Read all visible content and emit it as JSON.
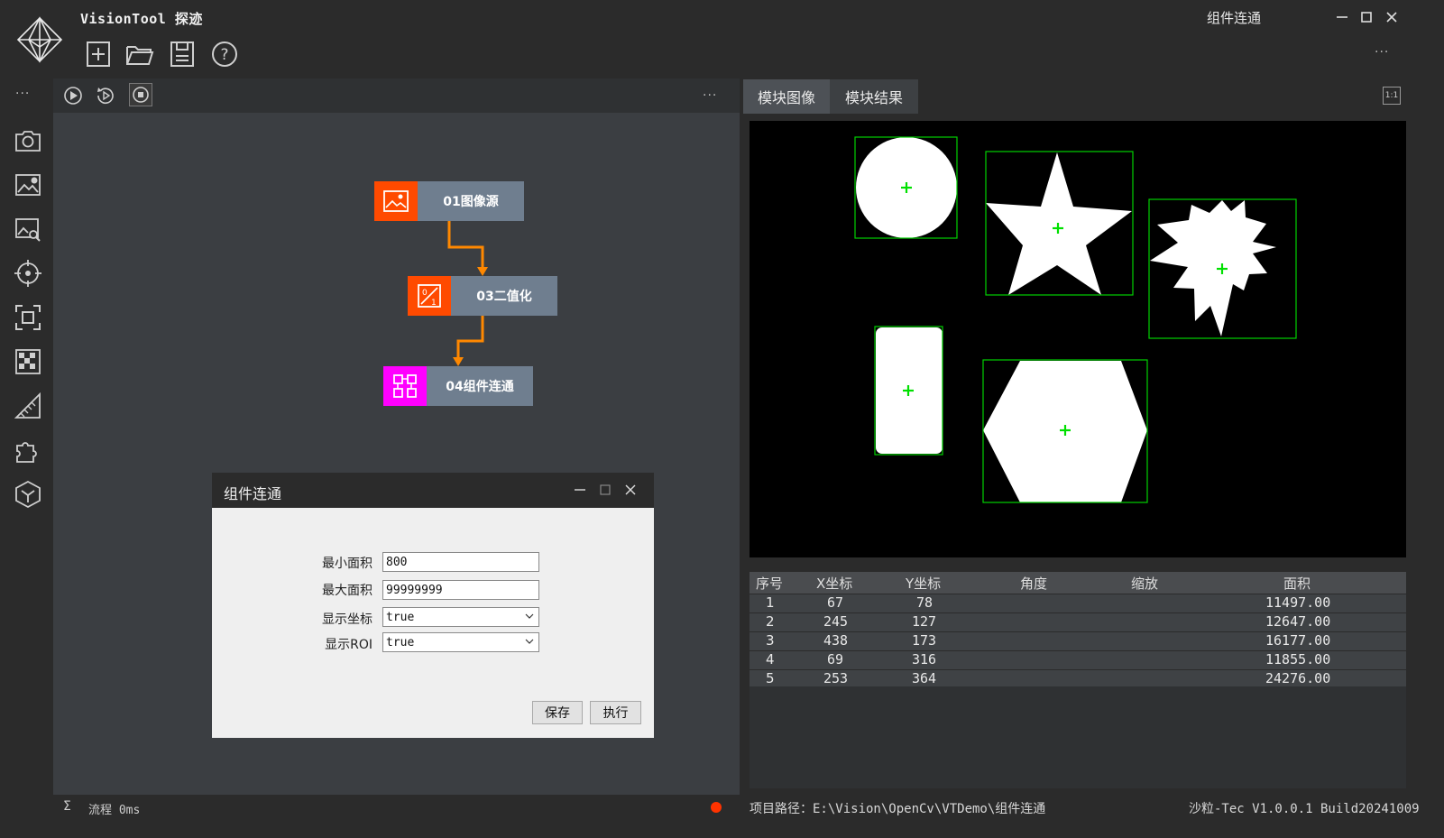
{
  "app": {
    "title": "VisionTool 探迹",
    "window_title": "组件连通",
    "toolbar_icons": [
      "new-file-icon",
      "open-folder-icon",
      "save-icon",
      "help-icon"
    ],
    "more_label": "···"
  },
  "sidebar": {
    "more_label": "···",
    "icons": [
      "camera-icon",
      "image-settings-icon",
      "image-search-icon",
      "target-icon",
      "scan-frame-icon",
      "checker-pattern-icon",
      "ruler-icon",
      "puzzle-icon",
      "cube-icon"
    ]
  },
  "flow": {
    "more_label": "···",
    "nodes": [
      {
        "label": "01图像源",
        "color": "#ff4a00",
        "icon": "image-icon"
      },
      {
        "label": "03二值化",
        "color": "#ff4a00",
        "icon": "binarize-icon"
      },
      {
        "label": "04组件连通",
        "color": "#ff00ff",
        "icon": "components-icon"
      }
    ],
    "status_symbol": "Σ",
    "status_text": "流程 0ms",
    "status_dot_color": "#ff3300"
  },
  "dialog": {
    "title": "组件连通",
    "fields": [
      {
        "label": "最小面积",
        "value": "800",
        "type": "text"
      },
      {
        "label": "最大面积",
        "value": "99999999",
        "type": "text"
      },
      {
        "label": "显示坐标",
        "value": "true",
        "type": "select"
      },
      {
        "label": "显示ROI",
        "value": "true",
        "type": "select"
      }
    ],
    "save_label": "保存",
    "run_label": "执行"
  },
  "result_panel": {
    "tabs": [
      "模块图像",
      "模块结果"
    ],
    "ratio_label": "1:1"
  },
  "table": {
    "headers": [
      "序号",
      "X坐标",
      "Y坐标",
      "角度",
      "缩放",
      "面积"
    ],
    "rows": [
      [
        "1",
        "67",
        "78",
        "",
        "",
        "11497.00"
      ],
      [
        "2",
        "245",
        "127",
        "",
        "",
        "12647.00"
      ],
      [
        "3",
        "438",
        "173",
        "",
        "",
        "16177.00"
      ],
      [
        "4",
        "69",
        "316",
        "",
        "",
        "11855.00"
      ],
      [
        "5",
        "253",
        "364",
        "",
        "",
        "24276.00"
      ]
    ]
  },
  "footer": {
    "path": "项目路径：E:\\Vision\\OpenCv\\VTDemo\\组件连通",
    "version": "沙粒-Tec V1.0.0.1 Build20241009"
  }
}
